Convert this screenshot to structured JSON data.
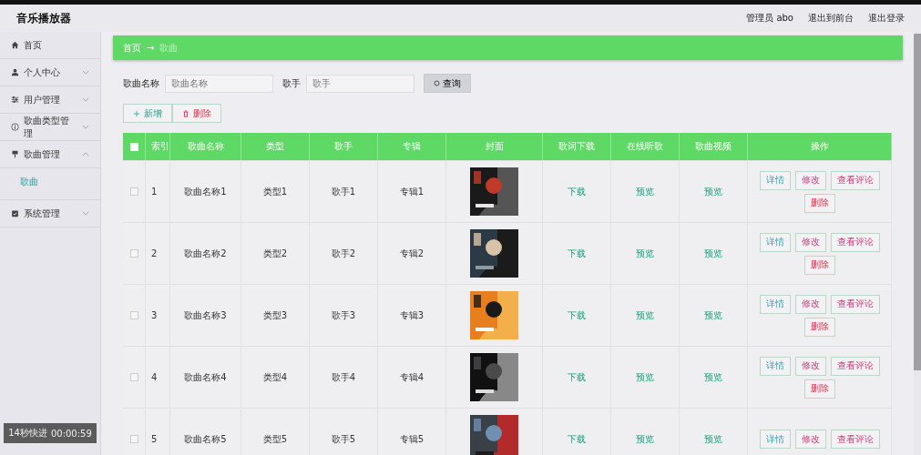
{
  "header": {
    "title": "音乐播放器",
    "links": [
      "管理员 abo",
      "退出到前台",
      "退出登录"
    ]
  },
  "sidebar": {
    "items": [
      {
        "label": "首页"
      },
      {
        "label": "个人中心",
        "expanded": false
      },
      {
        "label": "用户管理",
        "expanded": false
      },
      {
        "label": "歌曲类型管理",
        "expanded": false
      },
      {
        "label": "歌曲管理",
        "expanded": true,
        "children": [
          {
            "label": "歌曲",
            "selected": true
          }
        ]
      },
      {
        "label": "系统管理",
        "expanded": false
      }
    ]
  },
  "breadcrumb": [
    "首页",
    "→",
    "歌曲"
  ],
  "search": {
    "fields": [
      {
        "label": "歌曲名称",
        "placeholder": "歌曲名称"
      },
      {
        "label": "歌手",
        "placeholder": "歌手"
      }
    ],
    "button": "查询"
  },
  "actions": [
    {
      "label": "新增",
      "kind": "add"
    },
    {
      "label": "删除",
      "kind": "delete"
    }
  ],
  "table": {
    "select_all_checked": false,
    "columns": [
      "索引",
      "歌曲名称",
      "类型",
      "歌手",
      "专辑",
      "封面",
      "歌词下载",
      "在线听歌",
      "歌曲视频",
      "操作"
    ],
    "rows": [
      {
        "checked": false,
        "index": "1",
        "name": "歌曲名称1",
        "type": "类型1",
        "singer": "歌手1",
        "album": "专辑1",
        "lyrics": "下载",
        "listen": "预览",
        "video": "预览",
        "ops": [
          "详情",
          "修改",
          "查看评论",
          "删除"
        ]
      },
      {
        "checked": false,
        "index": "2",
        "name": "歌曲名称2",
        "type": "类型2",
        "singer": "歌手2",
        "album": "专辑2",
        "lyrics": "下载",
        "listen": "预览",
        "video": "预览",
        "ops": [
          "详情",
          "修改",
          "查看评论",
          "删除"
        ]
      },
      {
        "checked": false,
        "index": "3",
        "name": "歌曲名称3",
        "type": "类型3",
        "singer": "歌手3",
        "album": "专辑3",
        "lyrics": "下载",
        "listen": "预览",
        "video": "预览",
        "ops": [
          "详情",
          "修改",
          "查看评论",
          "删除"
        ]
      },
      {
        "checked": false,
        "index": "4",
        "name": "歌曲名称4",
        "type": "类型4",
        "singer": "歌手4",
        "album": "专辑4",
        "lyrics": "下载",
        "listen": "预览",
        "video": "预览",
        "ops": [
          "详情",
          "修改",
          "查看评论",
          "删除"
        ]
      },
      {
        "checked": false,
        "index": "5",
        "name": "歌曲名称5",
        "type": "类型5",
        "singer": "歌手5",
        "album": "专辑5",
        "lyrics": "下载",
        "listen": "预览",
        "video": "预览",
        "ops": [
          "详情",
          "修改",
          "查看评论"
        ]
      }
    ]
  },
  "recorder": {
    "label": "14秒快进",
    "time": "00:00:59"
  }
}
